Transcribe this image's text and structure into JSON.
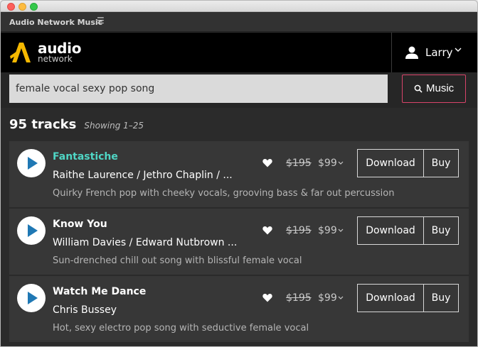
{
  "window": {
    "panel_title": "Audio Network Music",
    "panel_menu_icon": "hamburger-icon"
  },
  "brand": {
    "audio": "audio",
    "network": "network",
    "accent": "#f5b800"
  },
  "user": {
    "name": "Larry",
    "icon": "person-icon"
  },
  "search": {
    "value": "female vocal sexy pop song",
    "button_label": "Music",
    "button_icon": "search-icon",
    "button_border": "#d9446a"
  },
  "results": {
    "count": "95 tracks",
    "showing": "Showing 1–25"
  },
  "tracks": [
    {
      "title": "Fantastiche",
      "artists": "Raithe Laurence / Jethro Chaplin / ...",
      "description": "Quirky French pop with cheeky vocals, grooving bass & far out percussion",
      "price_old": "$195",
      "price_new": "$99",
      "download": "Download",
      "buy": "Buy"
    },
    {
      "title": "Know You",
      "artists": "William Davies / Edward Nutbrown ...",
      "description": "Sun-drenched chill out song with blissful female vocal",
      "price_old": "$195",
      "price_new": "$99",
      "download": "Download",
      "buy": "Buy"
    },
    {
      "title": "Watch Me Dance",
      "artists": "Chris Bussey",
      "description": "Hot, sexy electro pop song with seductive female vocal",
      "price_old": "$195",
      "price_new": "$99",
      "download": "Download",
      "buy": "Buy"
    }
  ],
  "colors": {
    "title_highlight": "#4fd6c5",
    "play_icon": "#1f78b4"
  }
}
